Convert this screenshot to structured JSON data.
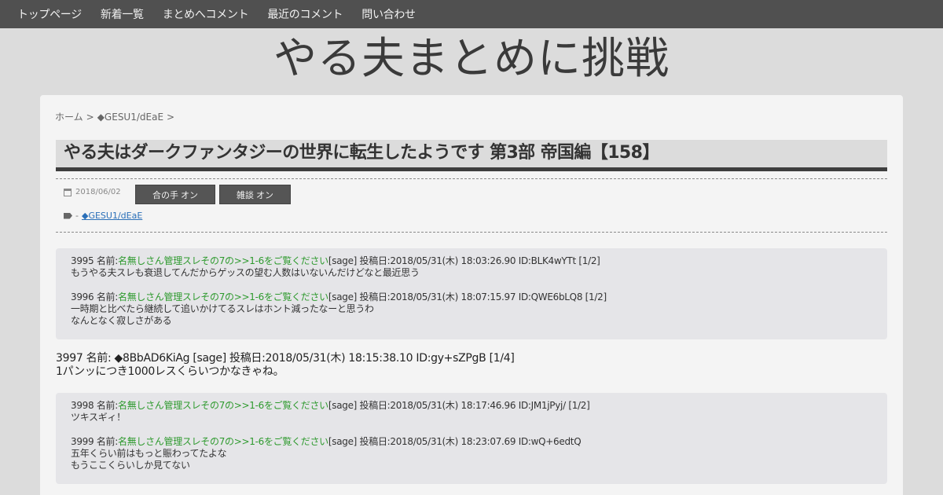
{
  "nav": {
    "items": [
      "トップページ",
      "新着一覧",
      "まとめへコメント",
      "最近のコメント",
      "問い合わせ"
    ]
  },
  "site": {
    "title": "やる夫まとめに挑戦"
  },
  "breadcrumb": {
    "home": "ホーム",
    "sep": ">",
    "author": "◆GESU1/dEaE",
    "trail": ">"
  },
  "post": {
    "title": "やる夫はダークファンタジーの世界に転生したようです 第3部 帝国編【158】",
    "date": "2018/06/02",
    "buttons": {
      "aite": "合の手 オン",
      "zatsu": "雑談 オン"
    },
    "tag_prefix": "-",
    "tag": "◆GESU1/dEaE"
  },
  "responses": {
    "r3995": {
      "num": "3995 名前:",
      "name": "名無しさん管理スレその7の>>1-6をご覧ください",
      "meta": "[sage] 投稿日:2018/05/31(木) 18:03:26.90 ID:BLK4wYTt [1/2]",
      "lines": [
        "もうやる夫スレも衰退してんだからゲッスの望む人数はいないんだけどなと最近思う"
      ]
    },
    "r3996": {
      "num": "3996 名前:",
      "name": "名無しさん管理スレその7の>>1-6をご覧ください",
      "meta": "[sage] 投稿日:2018/05/31(木) 18:07:15.97 ID:QWE6bLQ8 [1/2]",
      "lines": [
        "一時期と比べたら継続して追いかけてるスレはホント減ったなーと思うわ",
        "なんとなく寂しさがある"
      ]
    },
    "r3997": {
      "head": "3997 名前: ◆8BbAD6KiAg [sage] 投稿日:2018/05/31(木) 18:15:38.10 ID:gy+sZPgB [1/4]",
      "lines": [
        "1パンッにつき1000レスくらいつかなきゃね。"
      ]
    },
    "r3998": {
      "num": "3998 名前:",
      "name": "名無しさん管理スレその7の>>1-6をご覧ください",
      "meta": "[sage] 投稿日:2018/05/31(木) 18:17:46.96 ID:JM1jPyj/ [1/2]",
      "lines": [
        "ツキスギィ！"
      ]
    },
    "r3999": {
      "num": "3999 名前:",
      "name": "名無しさん管理スレその7の>>1-6をご覧ください",
      "meta": "[sage] 投稿日:2018/05/31(木) 18:23:07.69 ID:wQ+6edtQ",
      "lines": [
        "五年くらい前はもっと賑わってたよな",
        "もうここくらいしか見てない"
      ]
    }
  }
}
